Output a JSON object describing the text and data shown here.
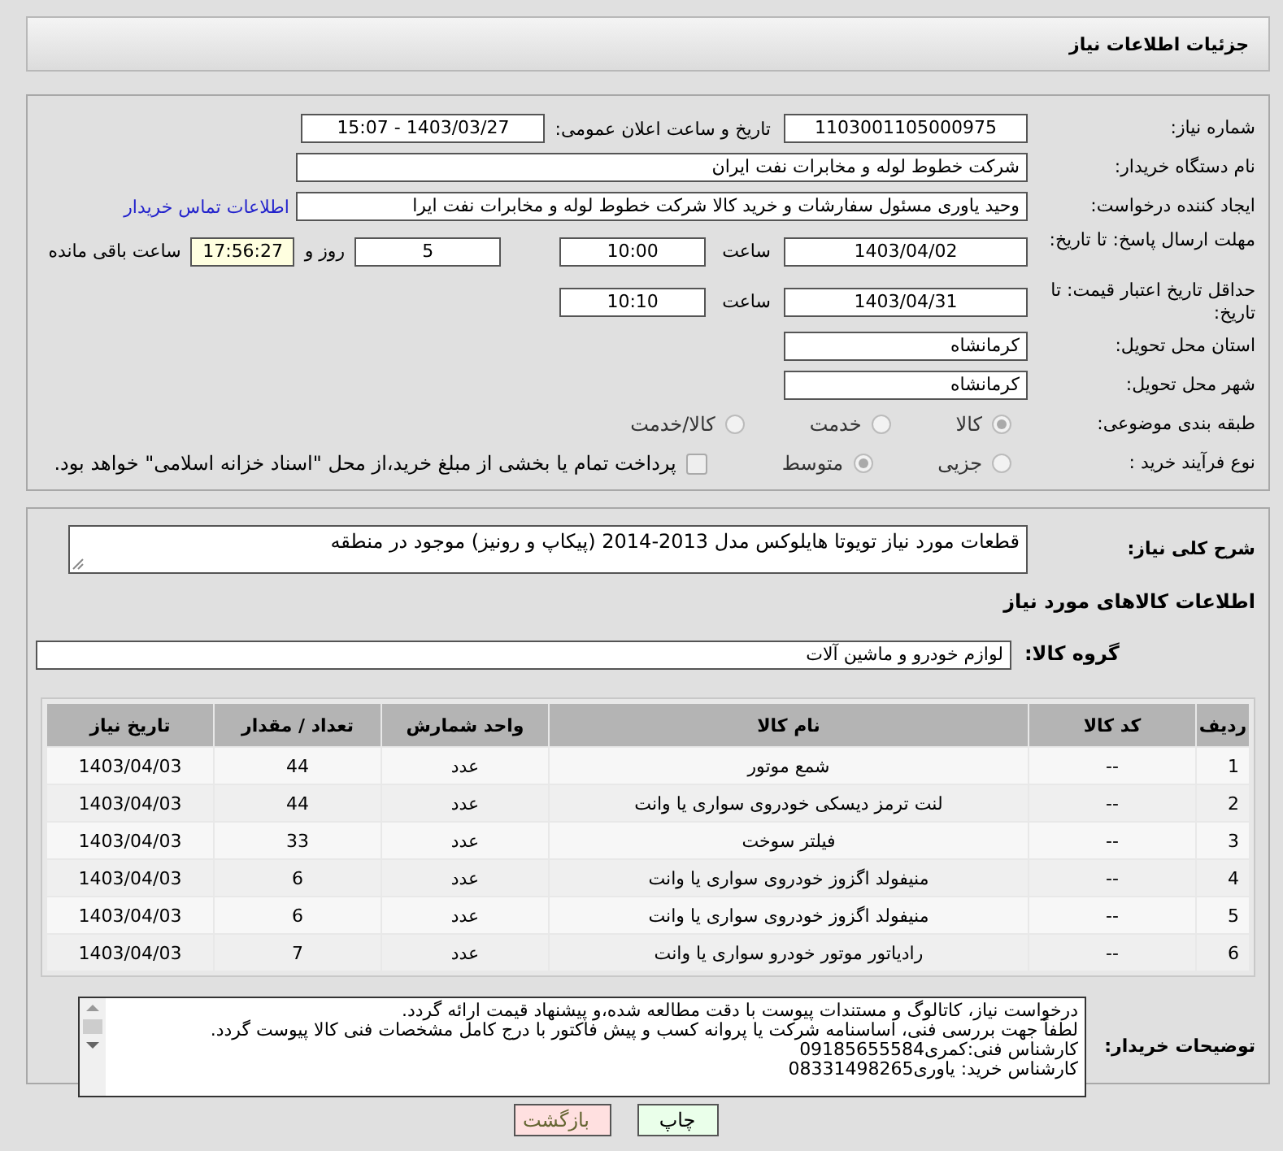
{
  "header": {
    "title": "جزئیات اطلاعات نیاز"
  },
  "need_number": {
    "label": "شماره نیاز:",
    "value": "1103001105000975"
  },
  "announce_datetime": {
    "label": "تاریخ و ساعت اعلان عمومی:",
    "value": "1403/03/27 - 15:07"
  },
  "buyer_org": {
    "label": "نام دستگاه خریدار:",
    "value": "شرکت خطوط لوله و مخابرات نفت ایران"
  },
  "requester": {
    "label": "ایجاد کننده درخواست:",
    "value": "وحید یاوری مسئول سفارشات و خرید کالا  شرکت خطوط لوله و مخابرات نفت ایرا",
    "contact_link": "اطلاعات تماس خریدار"
  },
  "response_deadline": {
    "label": "مهلت ارسال پاسخ: تا تاریخ:",
    "date": "1403/04/02",
    "time_label": "ساعت",
    "time": "10:00",
    "days": "5",
    "days_label": "روز و",
    "remaining": "17:56:27",
    "remaining_label": "ساعت باقی مانده"
  },
  "price_validity": {
    "label": "حداقل تاریخ اعتبار قیمت: تا تاریخ:",
    "date": "1403/04/31",
    "time_label": "ساعت",
    "time": "10:10"
  },
  "province": {
    "label": "استان محل تحویل:",
    "value": "کرمانشاه"
  },
  "city": {
    "label": "شهر محل تحویل:",
    "value": "کرمانشاه"
  },
  "category": {
    "label": "طبقه بندی موضوعی:",
    "options": [
      {
        "label": "کالا",
        "selected": true
      },
      {
        "label": "خدمت",
        "selected": false
      },
      {
        "label": "کالا/خدمت",
        "selected": false
      }
    ]
  },
  "purchase_type": {
    "label": "نوع فرآیند خرید :",
    "options": [
      {
        "label": "جزیی",
        "selected": false
      },
      {
        "label": "متوسط",
        "selected": true
      }
    ],
    "payment_note": {
      "checked": false,
      "text": "پرداخت تمام یا بخشی از مبلغ خرید،از محل \"اسناد خزانه اسلامی\" خواهد بود."
    }
  },
  "description": {
    "label": "شرح کلی نیاز:",
    "value": "قطعات مورد نیاز تویوتا هایلوکس مدل 2013-2014 (پیکاپ و رونیز) موجود در منطقه"
  },
  "goods_heading": "اطلاعات کالاهای مورد نیاز",
  "goods_group": {
    "label": "گروه کالا:",
    "value": "لوازم خودرو و ماشین آلات"
  },
  "table": {
    "columns": [
      "ردیف",
      "کد کالا",
      "نام کالا",
      "واحد شمارش",
      "تعداد / مقدار",
      "تاریخ نیاز"
    ],
    "rows": [
      [
        "1",
        "--",
        "شمع موتور",
        "عدد",
        "44",
        "1403/04/03"
      ],
      [
        "2",
        "--",
        "لنت ترمز دیسکی خودروی سواری یا وانت",
        "عدد",
        "44",
        "1403/04/03"
      ],
      [
        "3",
        "--",
        "فیلتر سوخت",
        "عدد",
        "33",
        "1403/04/03"
      ],
      [
        "4",
        "--",
        "منیفولد اگزوز خودروی سواری یا وانت",
        "عدد",
        "6",
        "1403/04/03"
      ],
      [
        "5",
        "--",
        "منیفولد اگزوز خودروی سواری یا وانت",
        "عدد",
        "6",
        "1403/04/03"
      ],
      [
        "6",
        "--",
        "رادیاتور موتور خودرو سواری یا وانت",
        "عدد",
        "7",
        "1403/04/03"
      ]
    ]
  },
  "buyer_notes": {
    "label": "توضیحات خریدار:",
    "lines": [
      "درخواست نیاز، کاتالوگ و مستندات پیوست با دقت مطالعه شده،و پیشنهاد قیمت ارائه گردد.",
      "لطفاً جهت بررسی فنی، اساسنامه شرکت یا پروانه کسب و پیش فاکتور با درج کامل مشخصات فنی کالا پیوست گردد.",
      "کارشناس فنی:کمری09185655584",
      "کارشناس خرید: یاوری08331498265"
    ]
  },
  "buttons": [
    {
      "label": "چاپ",
      "kind": "print"
    },
    {
      "label": "بازگشت",
      "kind": "back"
    }
  ]
}
